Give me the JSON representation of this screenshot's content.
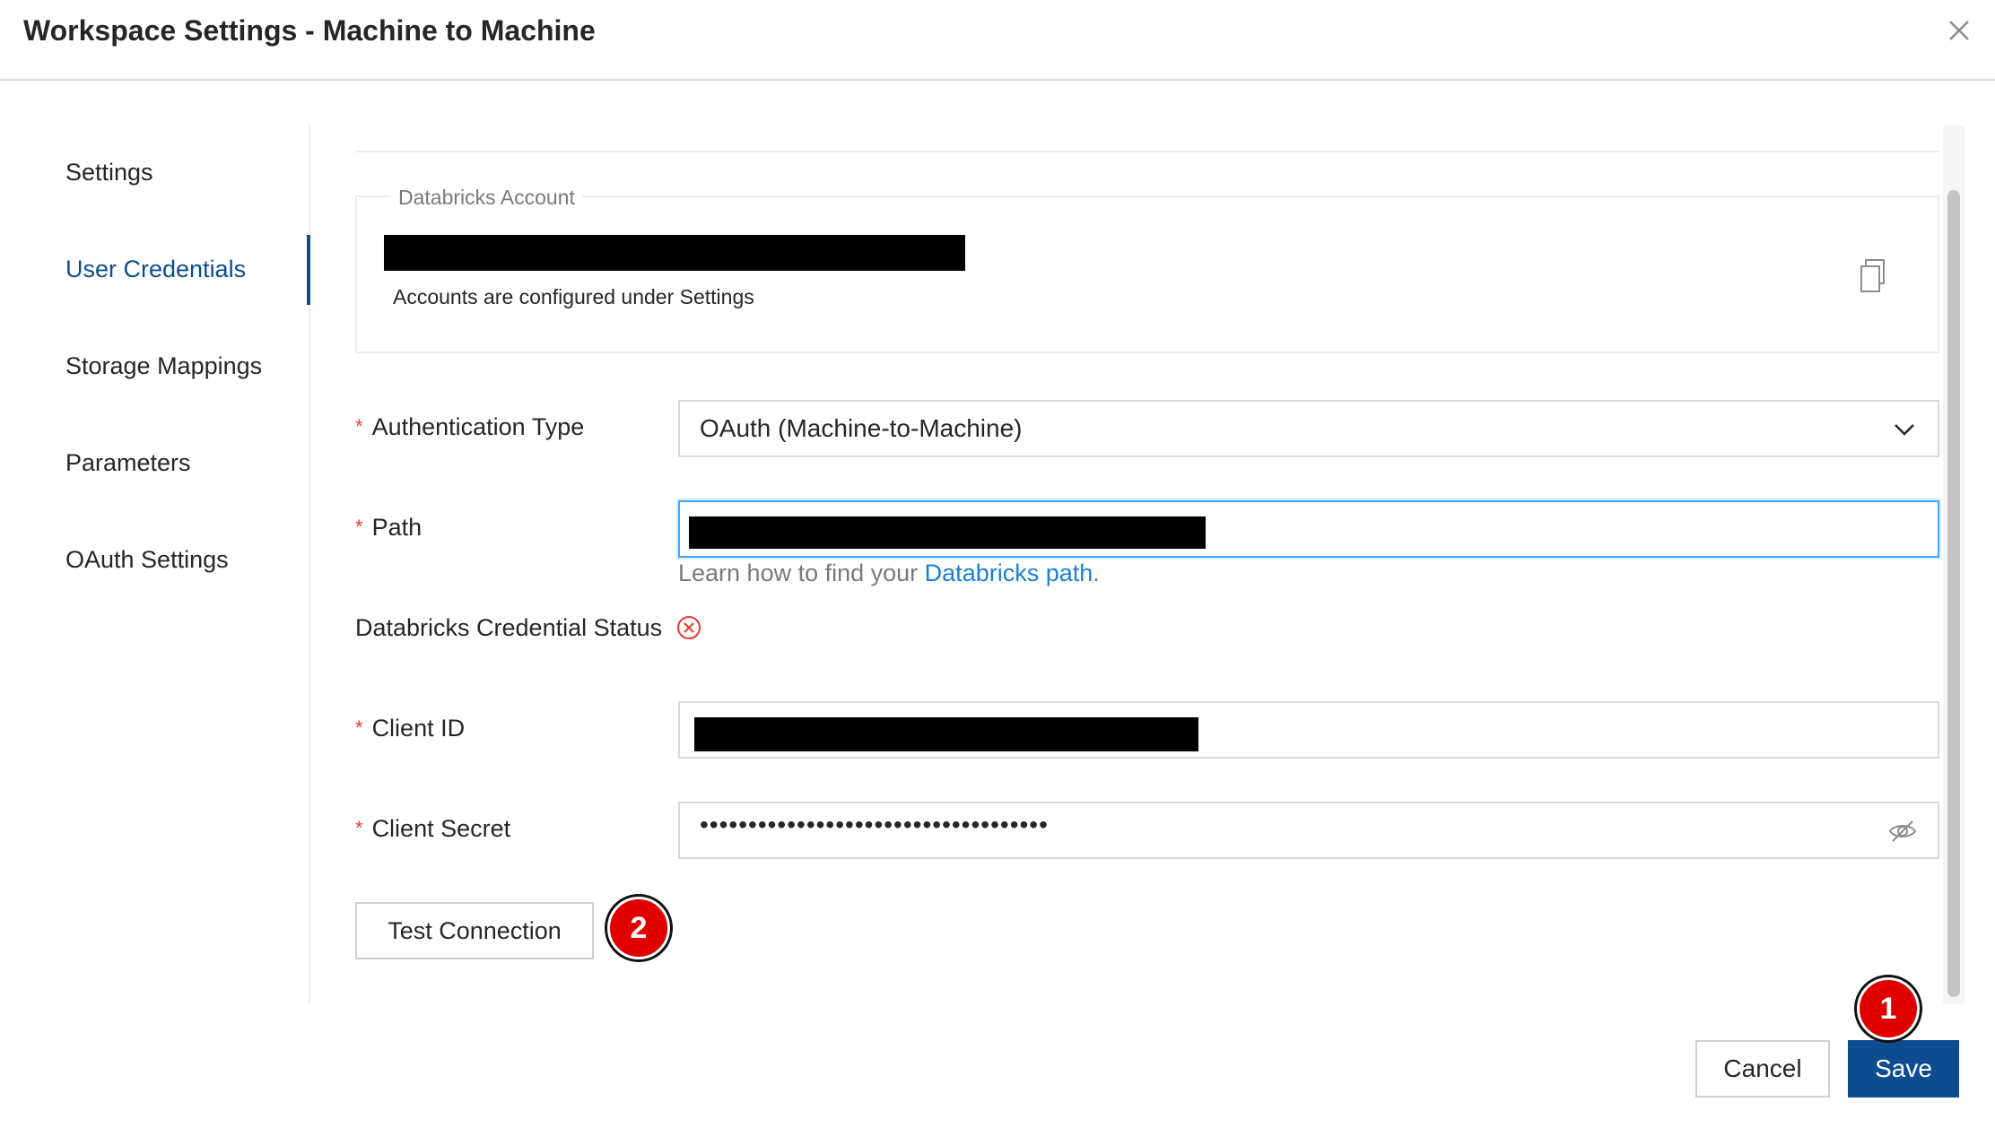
{
  "dialog": {
    "title": "Workspace Settings - Machine to Machine"
  },
  "sidebar": {
    "items": [
      {
        "label": "Settings"
      },
      {
        "label": "User Credentials",
        "active": true
      },
      {
        "label": "Storage Mappings"
      },
      {
        "label": "Parameters"
      },
      {
        "label": "OAuth Settings"
      }
    ]
  },
  "account": {
    "legend": "Databricks Account",
    "note": "Accounts are configured under Settings"
  },
  "form": {
    "auth_type": {
      "label": "Authentication Type",
      "value": "OAuth (Machine-to-Machine)"
    },
    "path": {
      "label": "Path",
      "help_prefix": "Learn how to find your ",
      "help_link": "Databricks path",
      "help_suffix": "."
    },
    "status": {
      "label": "Databricks Credential Status"
    },
    "client_id": {
      "label": "Client ID"
    },
    "client_secret": {
      "label": "Client Secret",
      "masked": "••••••••••••••••••••••••••••••••••••"
    },
    "required_mark": "*",
    "test_button": "Test Connection"
  },
  "footer": {
    "cancel": "Cancel",
    "save": "Save"
  },
  "annotations": {
    "marker1": "1",
    "marker2": "2"
  },
  "colors": {
    "accent": "#0d4d8f",
    "link": "#1a7fd4",
    "required": "#e53935",
    "marker": "#e00000"
  }
}
